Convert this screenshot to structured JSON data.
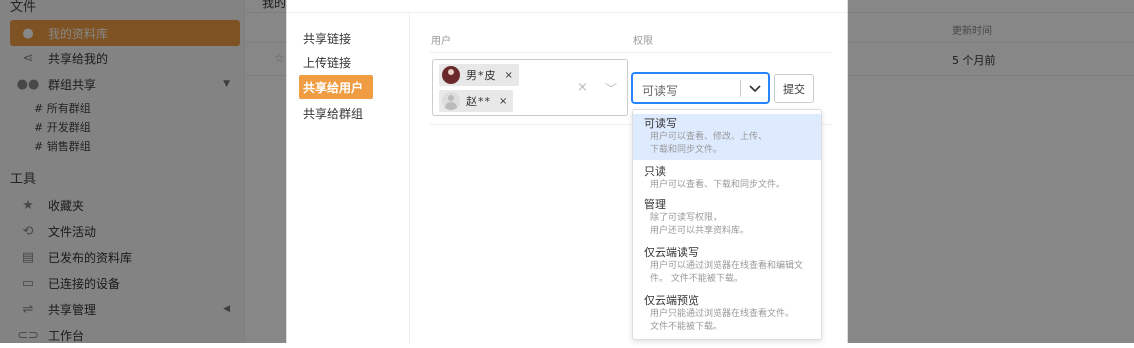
{
  "sidebar": {
    "files_heading": "文件",
    "items": [
      {
        "label": "我的资料库",
        "icon": "person-icon"
      },
      {
        "label": "共享给我的",
        "icon": "share-icon"
      },
      {
        "label": "群组共享",
        "icon": "group-icon"
      }
    ],
    "groups": [
      "# 所有群组",
      "# 开发群组",
      "# 销售群组"
    ],
    "tools_heading": "工具",
    "tools": [
      {
        "label": "收藏夹",
        "icon": "star-icon"
      },
      {
        "label": "文件活动",
        "icon": "history-icon"
      },
      {
        "label": "已发布的资料库",
        "icon": "published-icon"
      },
      {
        "label": "已连接的设备",
        "icon": "monitor-icon"
      },
      {
        "label": "共享管理",
        "icon": "share-admin-icon"
      },
      {
        "label": "工作台",
        "icon": "link-icon"
      }
    ]
  },
  "main": {
    "header_title": "我的",
    "col_updated": "更新时间",
    "row_updated": "5 个月前"
  },
  "modal": {
    "nav": [
      "共享链接",
      "上传链接",
      "共享给用户",
      "共享给群组"
    ],
    "active_nav": "共享给用户",
    "user_label": "用户",
    "permission_label": "权限",
    "chips": [
      {
        "name": "男*皮",
        "avatar": "dark"
      },
      {
        "name": "赵**",
        "avatar": "default"
      }
    ],
    "chip_remove": "×",
    "clear_icon": "×",
    "box_chevron": "﹀",
    "permission_value": "可读写",
    "submit_label": "提交",
    "options": [
      {
        "title": "可读写",
        "desc": [
          "用户可以查看、修改、上传、",
          "下载和同步文件。"
        ],
        "selected": true
      },
      {
        "title": "只读",
        "desc": [
          "用户可以查看、下载和同步文件。"
        ],
        "selected": false
      },
      {
        "title": "管理",
        "desc": [
          "除了可读写权限，",
          "用户还可以共享资料库。"
        ],
        "selected": false
      },
      {
        "title": "仅云端读写",
        "desc": [
          "用户可以通过浏览器在线查看和编辑文",
          "件。 文件不能被下载。"
        ],
        "selected": false
      },
      {
        "title": "仅云端预览",
        "desc": [
          "用户只能通过浏览器在线查看文件。",
          "文件不能被下载。"
        ],
        "selected": false
      }
    ]
  },
  "colors": {
    "accent": "#f09c42",
    "focus": "#2684ff",
    "selected_option": "#deebff"
  }
}
